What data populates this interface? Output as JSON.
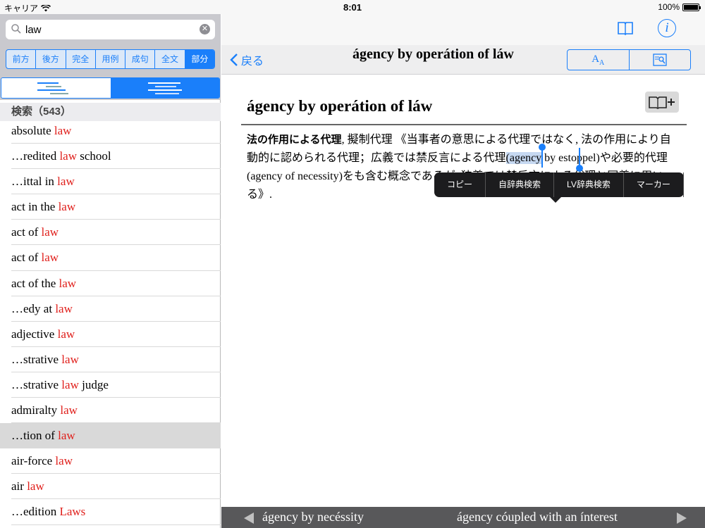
{
  "status_bar": {
    "carrier": "キャリア",
    "time": "8:01",
    "battery": "100%"
  },
  "search": {
    "query": "law",
    "placeholder": ""
  },
  "search_modes": [
    "前方",
    "後方",
    "完全",
    "用例",
    "成句",
    "全文",
    "部分"
  ],
  "active_search_mode": "部分",
  "results_header": "検索（543）",
  "results": [
    {
      "pre": "absolute ",
      "kw": "law",
      "post": ""
    },
    {
      "pre": "…redited ",
      "kw": "law",
      "post": " school"
    },
    {
      "pre": "…ittal in ",
      "kw": "law",
      "post": ""
    },
    {
      "pre": "act in the ",
      "kw": "law",
      "post": ""
    },
    {
      "pre": "act of ",
      "kw": "law",
      "post": ""
    },
    {
      "pre": "act of ",
      "kw": "law",
      "post": ""
    },
    {
      "pre": "act of the ",
      "kw": "law",
      "post": ""
    },
    {
      "pre": "…edy at ",
      "kw": "law",
      "post": ""
    },
    {
      "pre": "adjective ",
      "kw": "law",
      "post": ""
    },
    {
      "pre": "…strative ",
      "kw": "law",
      "post": ""
    },
    {
      "pre": "…strative ",
      "kw": "law",
      "post": " judge"
    },
    {
      "pre": "admiralty ",
      "kw": "law",
      "post": ""
    },
    {
      "pre": "…tion of ",
      "kw": "law",
      "post": ""
    },
    {
      "pre": "air-force ",
      "kw": "law",
      "post": ""
    },
    {
      "pre": "air ",
      "kw": "law",
      "post": ""
    },
    {
      "pre": "…edition ",
      "kw": "Laws",
      "post": ""
    }
  ],
  "selected_result_index": 12,
  "nav": {
    "back_label": "戻る",
    "title": "ágency by operátion of láw",
    "font_button_label": "AA"
  },
  "entry": {
    "headword": "ágency by operátion of láw",
    "definition": {
      "term": "法の作用による代理",
      "part1": ", 擬制代理 《当事者の意思による代理ではなく, 法の作用により自動的に認められる代理；広義では禁反言による代理",
      "selected": "(agency",
      "part2": " by estoppel)や必要的代理(agency of necessity)をも含む概念であるが, 狭義では禁反言による代理と同義に用いる》."
    }
  },
  "context_menu": [
    "コピー",
    "自辞典検索",
    "LV辞典検索",
    "マーカー"
  ],
  "bottom_nav": {
    "prev": "ágency by necéssity",
    "next": "ágency cóupled with an ínterest"
  },
  "colors": {
    "accent": "#1a7ffa",
    "keyword": "#e0201c"
  }
}
